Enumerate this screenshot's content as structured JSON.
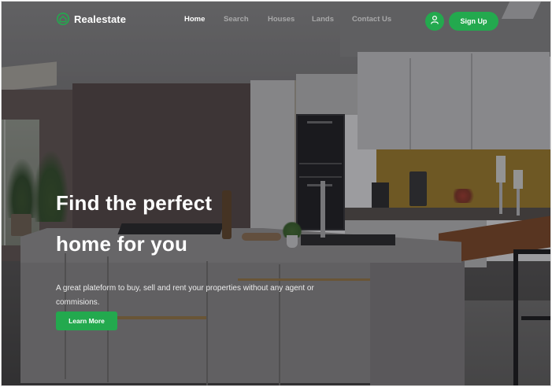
{
  "brand": {
    "name": "Realestate",
    "icon": "house-icon"
  },
  "nav": {
    "items": [
      {
        "label": "Home",
        "active": true
      },
      {
        "label": "Search",
        "active": false
      },
      {
        "label": "Houses",
        "active": false
      },
      {
        "label": "Lands",
        "active": false
      },
      {
        "label": "Contact Us",
        "active": false
      }
    ],
    "user_icon": "user-icon",
    "signup_label": "Sign Up"
  },
  "hero": {
    "title_line1": "Find the perfect",
    "title_line2": "home for you",
    "subtitle": "A great plateform to buy, sell and rent your properties without any agent or commisions.",
    "cta_label": "Learn More"
  },
  "colors": {
    "accent": "#23a94e",
    "text_primary": "#ffffff",
    "overlay": "rgba(18,20,26,0.42)"
  },
  "background": {
    "subject": "modern kitchen interior"
  }
}
